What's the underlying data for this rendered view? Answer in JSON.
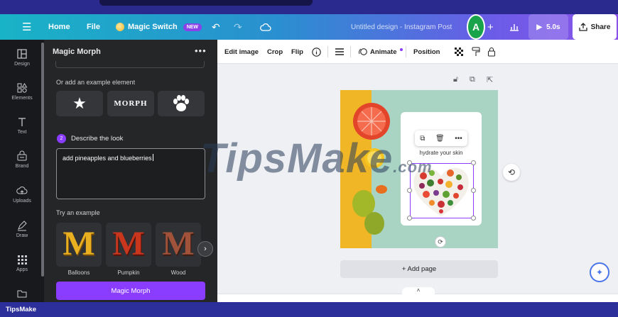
{
  "header": {
    "home": "Home",
    "file": "File",
    "magic_switch": "Magic Switch",
    "new_badge": "NEW",
    "doc_title": "Untitled design - Instagram Post",
    "avatar_letter": "A",
    "play_label": "5.0s",
    "share_label": "Share"
  },
  "rail": {
    "items": [
      {
        "label": "Design",
        "icon": "layout-icon"
      },
      {
        "label": "Elements",
        "icon": "shapes-icon"
      },
      {
        "label": "Text",
        "icon": "text-icon"
      },
      {
        "label": "Brand",
        "icon": "brand-icon"
      },
      {
        "label": "Uploads",
        "icon": "upload-cloud-icon"
      },
      {
        "label": "Draw",
        "icon": "draw-icon"
      },
      {
        "label": "Apps",
        "icon": "apps-grid-icon"
      }
    ]
  },
  "panel": {
    "title": "Magic Morph",
    "more": "•••",
    "example_label": "Or add an example element",
    "examples": [
      "★",
      "MORPH",
      "paw"
    ],
    "step_number": "2",
    "step_label": "Describe the look",
    "prompt_value": "add pineapples and blueberries",
    "try_label": "Try an example",
    "styles": [
      {
        "label": "Balloons",
        "letter": "M"
      },
      {
        "label": "Pumpkin",
        "letter": "M"
      },
      {
        "label": "Wood",
        "letter": "M"
      }
    ],
    "button": "Magic Morph"
  },
  "toolbar": {
    "edit_image": "Edit image",
    "crop": "Crop",
    "flip": "Flip",
    "animate": "Animate",
    "position": "Position"
  },
  "canvas": {
    "card_text": "hydrate your skin",
    "add_page": "+ Add page"
  },
  "watermark": {
    "text": "TipsMake",
    "suffix": ".com"
  },
  "footer": {
    "brand": "TipsMake"
  },
  "colors": {
    "accent": "#8b3dff",
    "rail_bg": "#18191c",
    "panel_bg": "#252627"
  }
}
